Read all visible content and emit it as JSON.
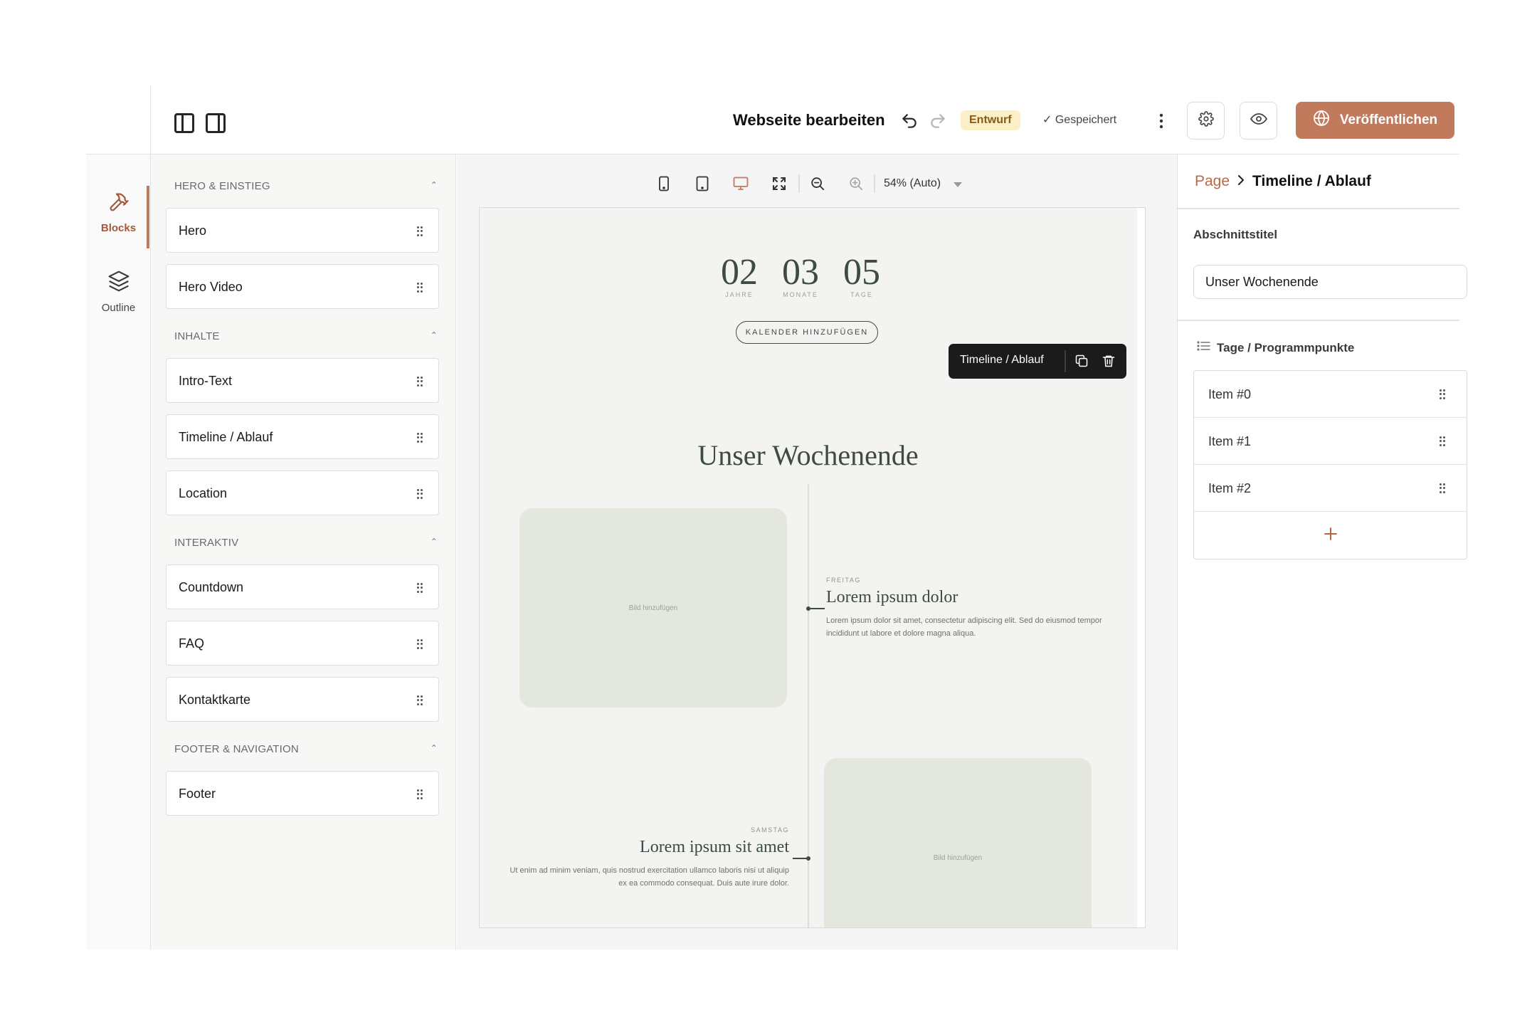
{
  "topbar": {
    "title": "Webseite bearbeiten",
    "status_badge": "Entwurf",
    "saved": "✓ Gespeichert",
    "publish_label": "Veröffentlichen"
  },
  "rail": {
    "items": [
      {
        "label": "Blocks",
        "icon": "hammer-icon",
        "active": true
      },
      {
        "label": "Outline",
        "icon": "layers-icon",
        "active": false
      }
    ]
  },
  "blocks": {
    "categories": [
      {
        "label": "HERO & EINSTIEG",
        "items": [
          "Hero",
          "Hero Video"
        ]
      },
      {
        "label": "INHALTE",
        "items": [
          "Intro-Text",
          "Timeline / Ablauf",
          "Location"
        ]
      },
      {
        "label": "INTERAKTIV",
        "items": [
          "Countdown",
          "FAQ",
          "Kontaktkarte"
        ]
      },
      {
        "label": "FOOTER & NAVIGATION",
        "items": [
          "Footer"
        ]
      }
    ]
  },
  "canvas": {
    "zoom": "54% (Auto)",
    "active_device": "desktop",
    "countdown": [
      {
        "value": "02",
        "unit": "JAHRE"
      },
      {
        "value": "03",
        "unit": "MONATE"
      },
      {
        "value": "05",
        "unit": "TAGE"
      }
    ],
    "calendar_button": "KALENDER HINZUFÜGEN",
    "selected_block_label": "Timeline / Ablauf",
    "section_title": "Unser Wochenende",
    "image_placeholder": "Bild hinzufügen",
    "events": [
      {
        "day": "FREITAG",
        "title": "Lorem ipsum dolor",
        "text": "Lorem ipsum dolor sit amet, consectetur adipiscing elit. Sed do eiusmod tempor incididunt ut labore et dolore magna aliqua."
      },
      {
        "day": "SAMSTAG",
        "title": "Lorem ipsum sit amet",
        "text": "Ut enim ad minim veniam, quis nostrud exercitation ullamco laboris nisi ut aliquip ex ea commodo consequat. Duis aute irure dolor."
      }
    ]
  },
  "inspector": {
    "breadcrumb": [
      "Page",
      "Timeline / Ablauf"
    ],
    "section_title_label": "Abschnittstitel",
    "section_title_value": "Unser Wochenende",
    "list_label": "Tage / Programmpunkte",
    "items": [
      "Item #0",
      "Item #1",
      "Item #2"
    ]
  },
  "colors": {
    "accent": "#c27a5d",
    "accent_text": "#a5593b",
    "badge_bg": "#fbefc7",
    "canvas_bg": "#f3f4f1",
    "sage_text": "#3e4a44",
    "image_placeholder": "#e3e7de",
    "float_toolbar": "#1b1b1b"
  }
}
